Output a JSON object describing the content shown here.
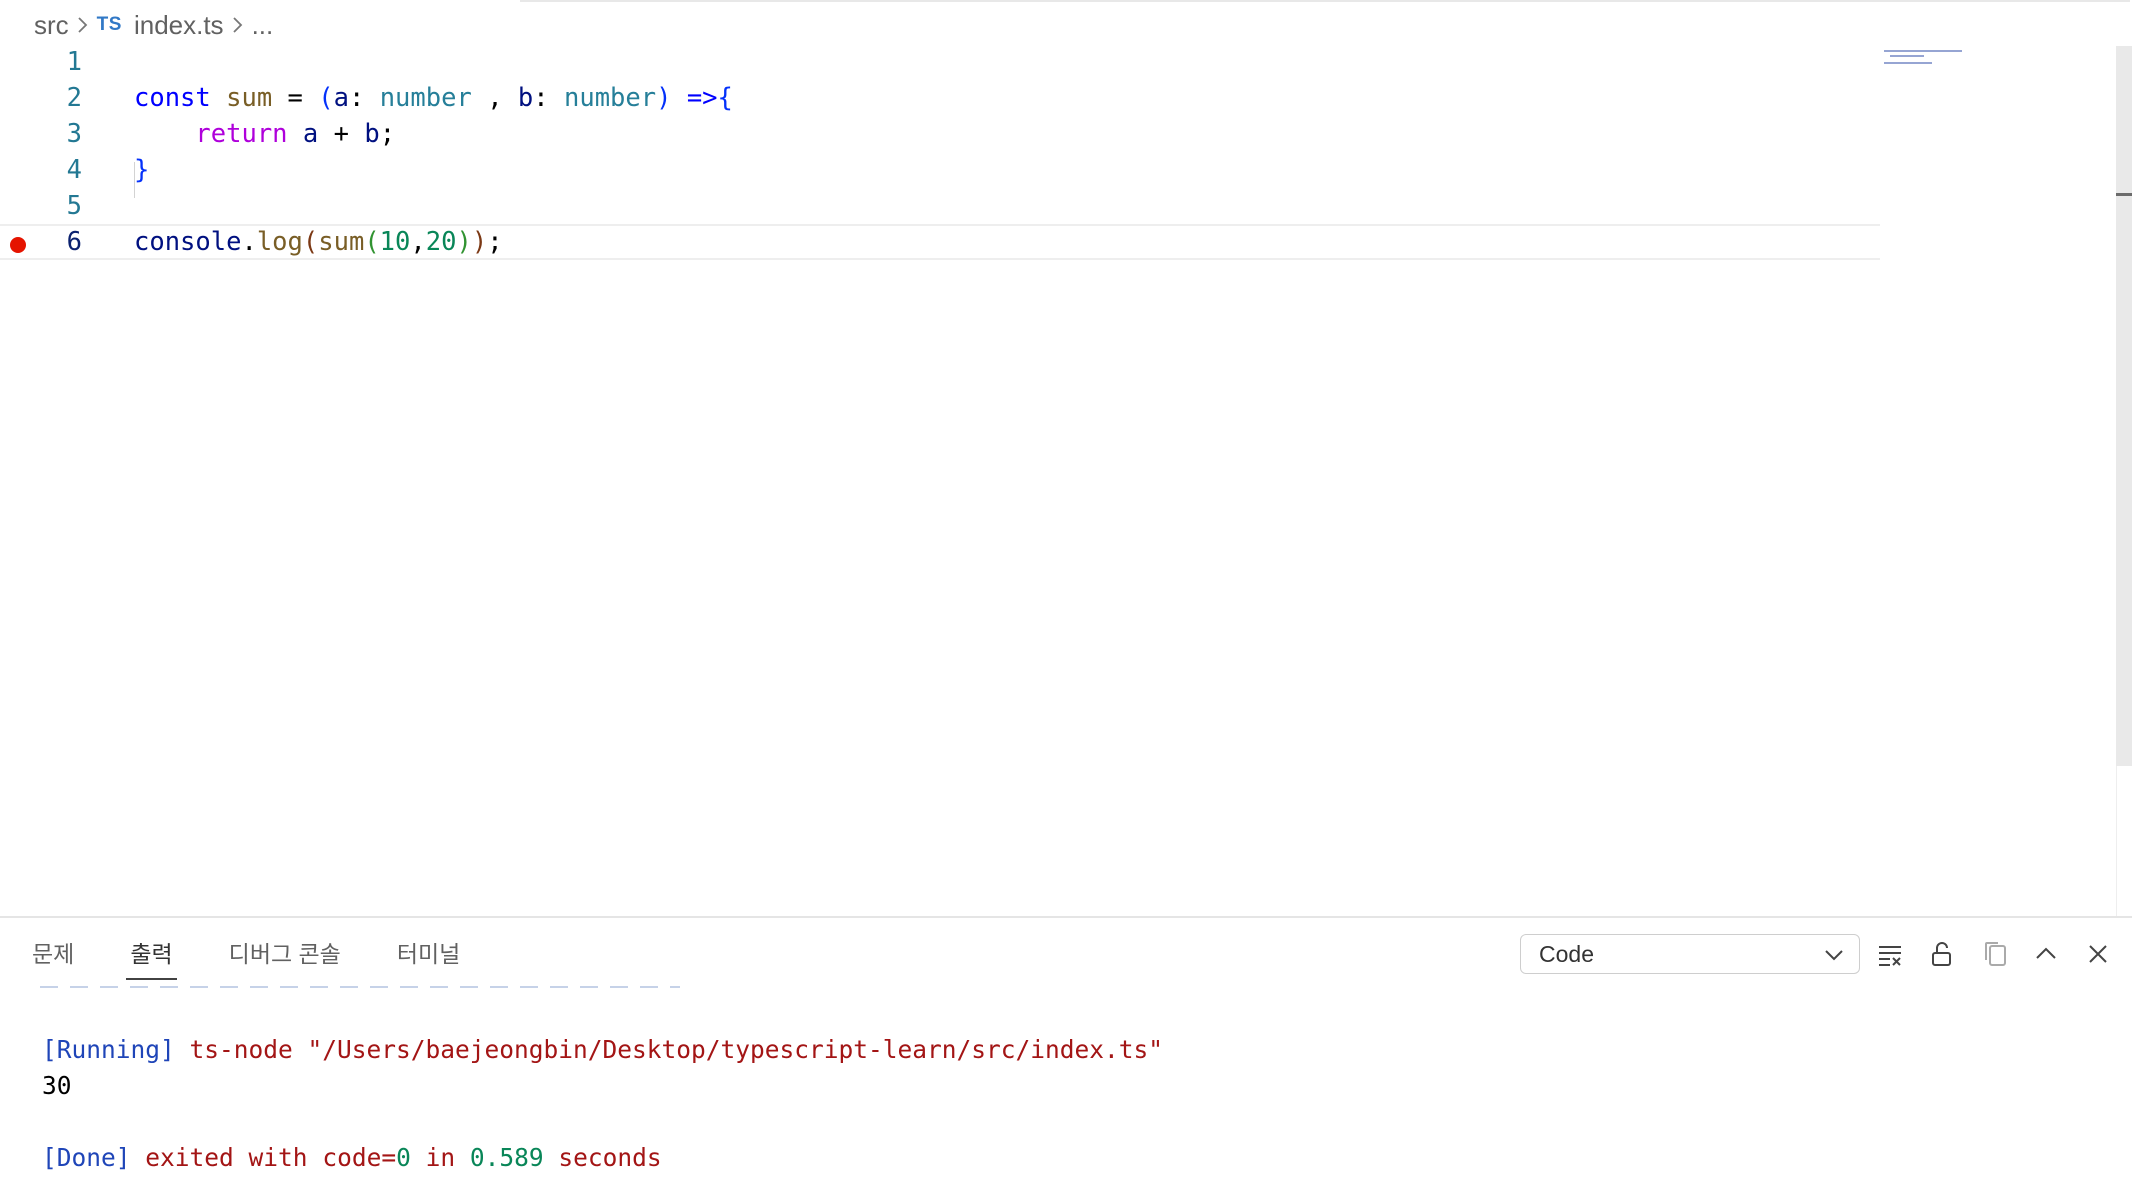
{
  "breadcrumb": {
    "folder": "src",
    "file_icon": "TS",
    "file": "index.ts",
    "more": "..."
  },
  "editor": {
    "lines": [
      {
        "number": "1"
      },
      {
        "number": "2",
        "tokens": [
          "const",
          "sum",
          "=",
          "(",
          "a",
          ":",
          "number",
          ",",
          "b",
          ":",
          "number",
          ")",
          "=>",
          "{"
        ]
      },
      {
        "number": "3",
        "tokens": [
          "return",
          "a",
          "+",
          "b",
          ";"
        ]
      },
      {
        "number": "4",
        "tokens": [
          "}"
        ]
      },
      {
        "number": "5"
      },
      {
        "number": "6",
        "tokens": [
          "console",
          ".",
          "log",
          "(",
          "sum",
          "(",
          "10",
          ",",
          "20",
          ")",
          ")",
          ";"
        ],
        "breakpoint": true,
        "current": true
      }
    ]
  },
  "panel": {
    "tabs": [
      "문제",
      "출력",
      "디버그 콘솔",
      "터미널"
    ],
    "active_tab": "출력",
    "channel_select": "Code",
    "actions": [
      "clear-output-icon",
      "lock-icon",
      "copy-icon",
      "maximize-icon",
      "close-icon"
    ],
    "output": {
      "running_tag": "[Running]",
      "running_cmd": "ts-node \"/Users/baejeongbin/Desktop/typescript-learn/src/index.ts\"",
      "result": "30",
      "done_tag": "[Done]",
      "done_text_1": "exited with",
      "done_code_label": "code=",
      "done_code": "0",
      "done_in": "in",
      "done_time": "0.589",
      "done_unit": "seconds"
    }
  },
  "colors": {
    "keyword": "#0000ff",
    "function": "#795e26",
    "type": "#267f99",
    "control": "#af00db",
    "number": "#098658",
    "breakpoint": "#e51400",
    "line_number": "#237893"
  }
}
